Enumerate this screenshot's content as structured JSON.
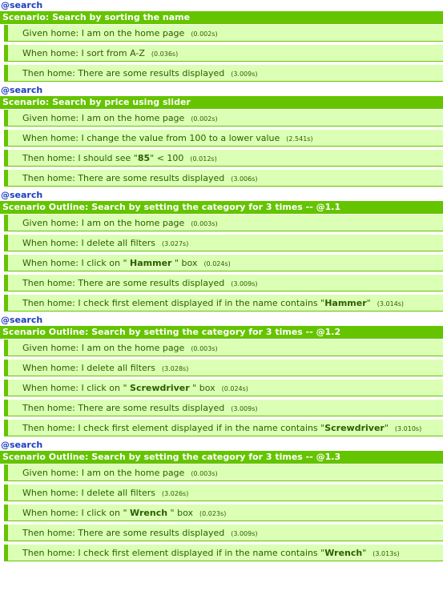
{
  "scenarios": [
    {
      "tag": "@search",
      "title": "Scenario: Search by sorting the name",
      "steps": [
        {
          "parts": [
            "Given home: I am on the home page"
          ],
          "duration": "(0.002s)"
        },
        {
          "parts": [
            "When home: I sort from A-Z"
          ],
          "duration": "(0.036s)"
        },
        {
          "parts": [
            "Then home: There are some results displayed"
          ],
          "duration": "(3.009s)"
        }
      ]
    },
    {
      "tag": "@search",
      "title": "Scenario: Search by price using slider",
      "steps": [
        {
          "parts": [
            "Given home: I am on the home page"
          ],
          "duration": "(0.002s)"
        },
        {
          "parts": [
            "When home: I change the value from 100 to a lower value"
          ],
          "duration": "(2.541s)"
        },
        {
          "parts": [
            "Then home: I should see \"",
            "85",
            "\" < 100"
          ],
          "duration": "(0.012s)"
        },
        {
          "parts": [
            "Then home: There are some results displayed"
          ],
          "duration": "(3.006s)"
        }
      ]
    },
    {
      "tag": "@search",
      "title": "Scenario Outline: Search by setting the category for 3 times -- @1.1",
      "steps": [
        {
          "parts": [
            "Given home: I am on the home page"
          ],
          "duration": "(0.003s)"
        },
        {
          "parts": [
            "When home: I delete all filters"
          ],
          "duration": "(3.027s)"
        },
        {
          "parts": [
            "When home: I click on \" ",
            "Hammer",
            " \" box"
          ],
          "duration": "(0.024s)"
        },
        {
          "parts": [
            "Then home: There are some results displayed"
          ],
          "duration": "(3.009s)"
        },
        {
          "parts": [
            "Then home: I check first element displayed if in the name contains \"",
            "Hammer",
            "\""
          ],
          "duration": "(3.014s)"
        }
      ]
    },
    {
      "tag": "@search",
      "title": "Scenario Outline: Search by setting the category for 3 times -- @1.2",
      "steps": [
        {
          "parts": [
            "Given home: I am on the home page"
          ],
          "duration": "(0.003s)"
        },
        {
          "parts": [
            "When home: I delete all filters"
          ],
          "duration": "(3.028s)"
        },
        {
          "parts": [
            "When home: I click on \" ",
            "Screwdriver",
            " \" box"
          ],
          "duration": "(0.024s)"
        },
        {
          "parts": [
            "Then home: There are some results displayed"
          ],
          "duration": "(3.009s)"
        },
        {
          "parts": [
            "Then home: I check first element displayed if in the name contains \"",
            "Screwdriver",
            "\""
          ],
          "duration": "(3.010s)"
        }
      ]
    },
    {
      "tag": "@search",
      "title": "Scenario Outline: Search by setting the category for 3 times -- @1.3",
      "steps": [
        {
          "parts": [
            "Given home: I am on the home page"
          ],
          "duration": "(0.003s)"
        },
        {
          "parts": [
            "When home: I delete all filters"
          ],
          "duration": "(3.026s)"
        },
        {
          "parts": [
            "When home: I click on \" ",
            "Wrench",
            " \" box"
          ],
          "duration": "(0.023s)"
        },
        {
          "parts": [
            "Then home: There are some results displayed"
          ],
          "duration": "(3.009s)"
        },
        {
          "parts": [
            "Then home: I check first element displayed if in the name contains \"",
            "Wrench",
            "\""
          ],
          "duration": "(3.013s)"
        }
      ]
    }
  ]
}
